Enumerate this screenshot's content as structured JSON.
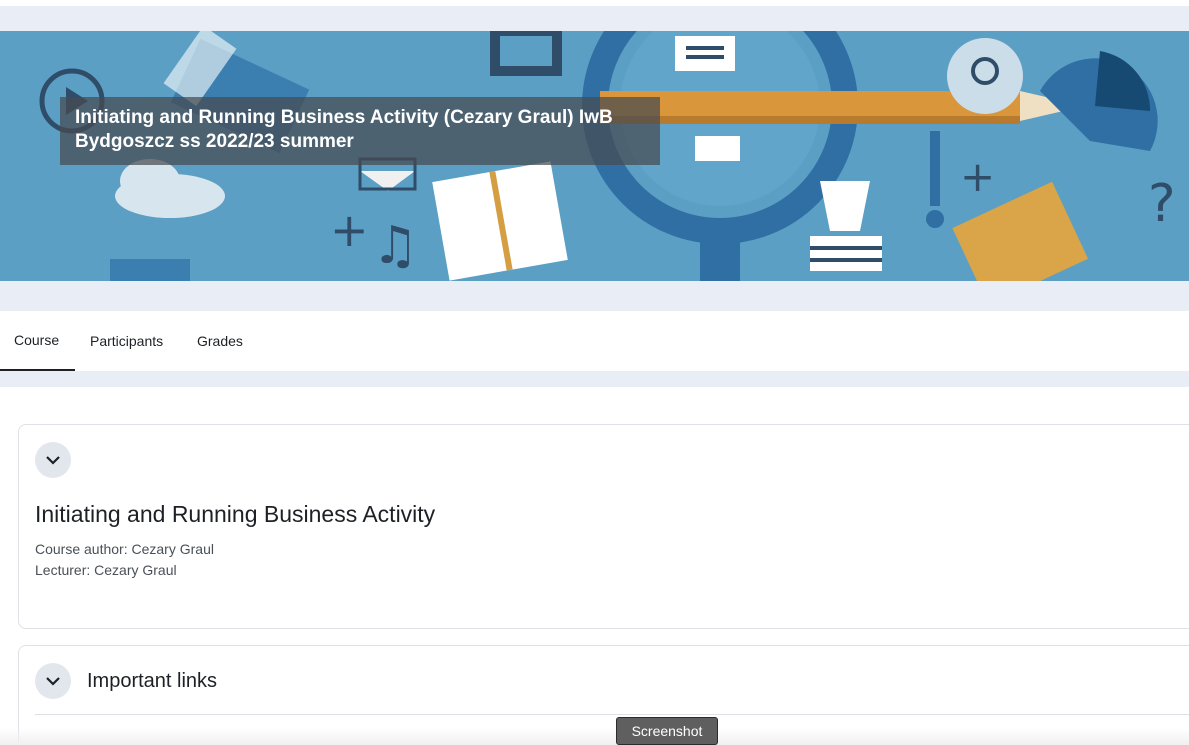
{
  "banner": {
    "title": "Initiating and Running Business Activity (Cezary Graul) IwB Bydgoszcz ss 2022/23 summer"
  },
  "nav": {
    "tabs": [
      {
        "label": "Course",
        "active": true
      },
      {
        "label": "Participants",
        "active": false
      },
      {
        "label": "Grades",
        "active": false
      }
    ]
  },
  "sections": {
    "general": {
      "title": "Initiating and Running Business Activity",
      "author": "Course author: Cezary Graul",
      "lecturer": "Lecturer: Cezary Graul"
    },
    "links": {
      "title": "Important links"
    }
  },
  "overlay": {
    "screenshot_label": "Screenshot"
  },
  "colors": {
    "background_band": "#e9eef6",
    "banner_blue": "#5a9ec2",
    "text": "#1d2125"
  }
}
